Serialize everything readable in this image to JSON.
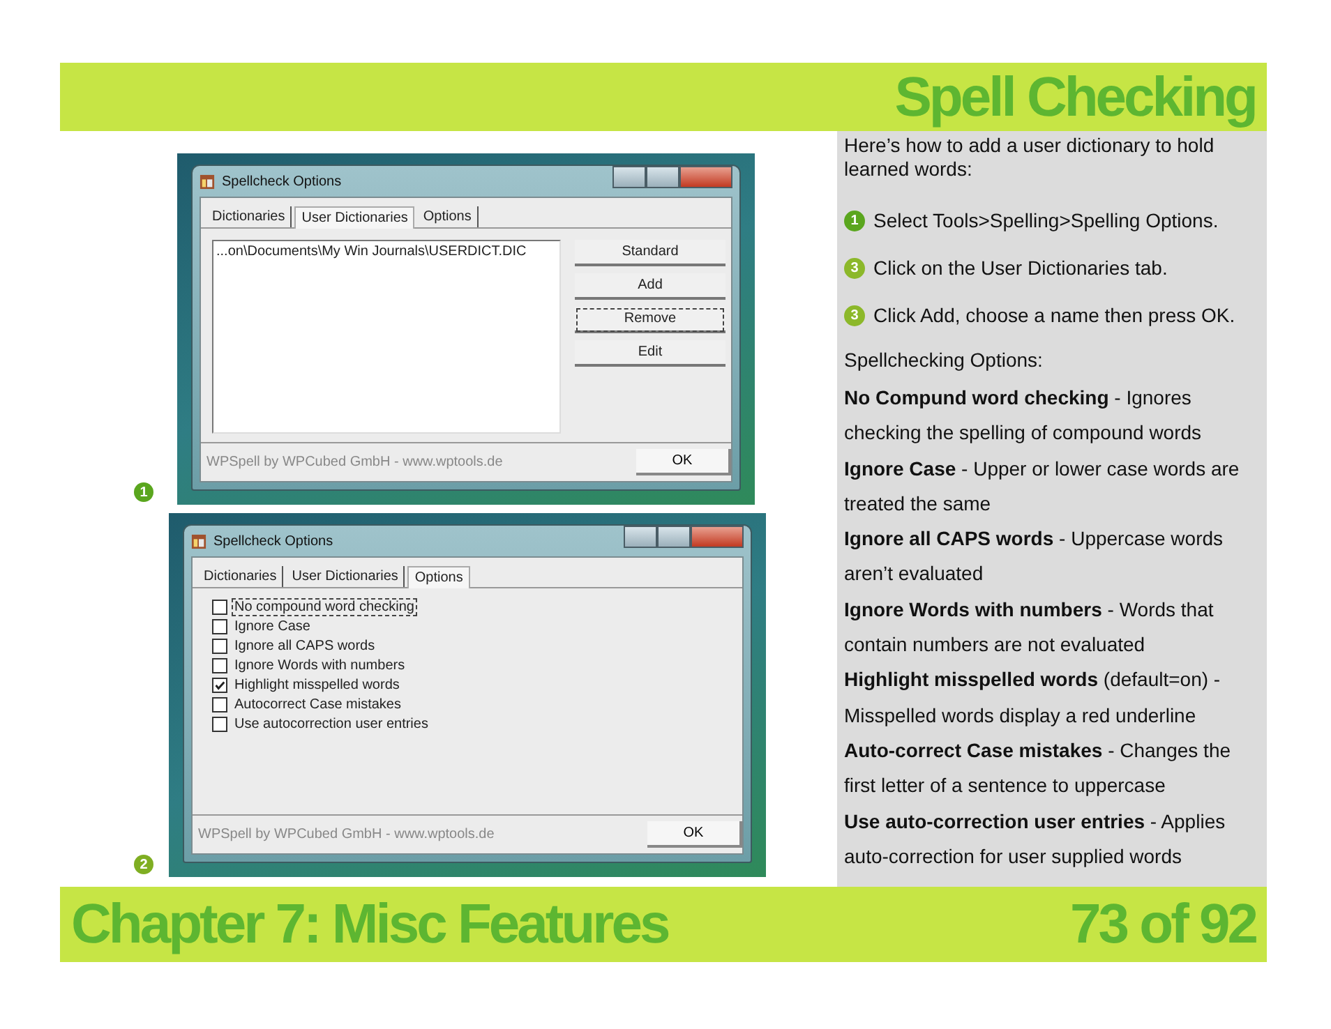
{
  "header": {
    "title": "Spell Checking"
  },
  "screenshots": [
    {
      "marker": {
        "text": "1",
        "color": "#5aa61e"
      },
      "dialog": {
        "title": "Spellcheck Options",
        "kind": "dictionaries",
        "tabs": [
          {
            "label": "Dictionaries",
            "selected": false
          },
          {
            "label": "User Dictionaries",
            "selected": true
          },
          {
            "label": "Options",
            "selected": false
          }
        ],
        "list_items": [
          "...on\\Documents\\My Win Journals\\USERDICT.DIC"
        ],
        "buttons": [
          {
            "label": "Standard",
            "focused": false
          },
          {
            "label": "Add",
            "focused": false
          },
          {
            "label": "Remove",
            "focused": true
          },
          {
            "label": "Edit",
            "focused": false
          }
        ],
        "credit": "WPSpell by WPCubed GmbH - www.wptools.de",
        "ok": "OK"
      }
    },
    {
      "marker": {
        "text": "2",
        "color": "#7fae22"
      },
      "dialog": {
        "title": "Spellcheck Options",
        "kind": "options",
        "tabs": [
          {
            "label": "Dictionaries",
            "selected": false
          },
          {
            "label": "User Dictionaries",
            "selected": false
          },
          {
            "label": "Options",
            "selected": true
          }
        ],
        "options": [
          {
            "label": "No compound word checking",
            "checked": false,
            "focused": true
          },
          {
            "label": "Ignore Case",
            "checked": false,
            "focused": false
          },
          {
            "label": "Ignore all CAPS words",
            "checked": false,
            "focused": false
          },
          {
            "label": "Ignore Words with numbers",
            "checked": false,
            "focused": false
          },
          {
            "label": "Highlight misspelled words",
            "checked": true,
            "focused": false
          },
          {
            "label": "Autocorrect Case mistakes",
            "checked": false,
            "focused": false
          },
          {
            "label": "Use autocorrection user entries",
            "checked": false,
            "focused": false
          }
        ],
        "credit": "WPSpell by WPCubed GmbH - www.wptools.de",
        "ok": "OK"
      }
    }
  ],
  "sidebar": {
    "intro": "Here’s how to add a user dictionary to hold learned words:",
    "steps": [
      {
        "number": "1",
        "color": "#5aa61e",
        "text": "Select Tools>Spelling>Spelling Options."
      },
      {
        "number": "3",
        "color": "#8cb82a",
        "text": "Click on the User Dictionaries tab."
      },
      {
        "number": "3",
        "color": "#8cb82a",
        "text": "Click Add, choose a name then press OK."
      }
    ],
    "subheading": "Spellchecking Options:",
    "descriptions": [
      "**No Compund word checking** - Ignores checking the spelling of compound words",
      "**Ignore Case** - Upper or lower case words are treated the same",
      "**Ignore all CAPS words** - Uppercase words aren’t evaluated",
      "**Ignore Words with numbers** - Words that contain numbers are not evaluated",
      "**Highlight misspelled words** (default=on) - Misspelled words display a red underline",
      "**Auto-correct Case mistakes** - Changes the first letter of a sentence to uppercase",
      "**Use auto-correction user entries** - Applies auto-correction for user supplied words"
    ]
  },
  "footer": {
    "chapter": "Chapter 7: Misc Features",
    "page": "73 of 92"
  }
}
